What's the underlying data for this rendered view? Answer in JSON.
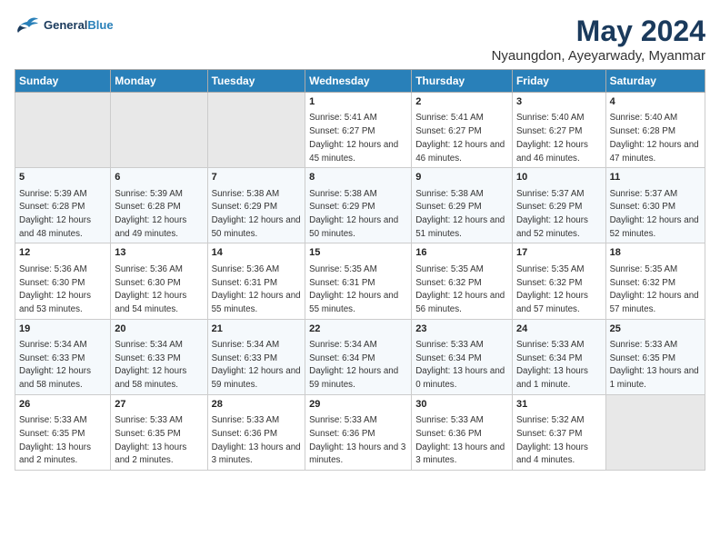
{
  "logo": {
    "line1": "General",
    "line2": "Blue"
  },
  "title": "May 2024",
  "subtitle": "Nyaungdon, Ayeyarwady, Myanmar",
  "days_of_week": [
    "Sunday",
    "Monday",
    "Tuesday",
    "Wednesday",
    "Thursday",
    "Friday",
    "Saturday"
  ],
  "weeks": [
    [
      {
        "day": "",
        "empty": true
      },
      {
        "day": "",
        "empty": true
      },
      {
        "day": "",
        "empty": true
      },
      {
        "day": "1",
        "sunrise": "5:41 AM",
        "sunset": "6:27 PM",
        "daylight": "12 hours and 45 minutes."
      },
      {
        "day": "2",
        "sunrise": "5:41 AM",
        "sunset": "6:27 PM",
        "daylight": "12 hours and 46 minutes."
      },
      {
        "day": "3",
        "sunrise": "5:40 AM",
        "sunset": "6:27 PM",
        "daylight": "12 hours and 46 minutes."
      },
      {
        "day": "4",
        "sunrise": "5:40 AM",
        "sunset": "6:28 PM",
        "daylight": "12 hours and 47 minutes."
      }
    ],
    [
      {
        "day": "5",
        "sunrise": "5:39 AM",
        "sunset": "6:28 PM",
        "daylight": "12 hours and 48 minutes."
      },
      {
        "day": "6",
        "sunrise": "5:39 AM",
        "sunset": "6:28 PM",
        "daylight": "12 hours and 49 minutes."
      },
      {
        "day": "7",
        "sunrise": "5:38 AM",
        "sunset": "6:29 PM",
        "daylight": "12 hours and 50 minutes."
      },
      {
        "day": "8",
        "sunrise": "5:38 AM",
        "sunset": "6:29 PM",
        "daylight": "12 hours and 50 minutes."
      },
      {
        "day": "9",
        "sunrise": "5:38 AM",
        "sunset": "6:29 PM",
        "daylight": "12 hours and 51 minutes."
      },
      {
        "day": "10",
        "sunrise": "5:37 AM",
        "sunset": "6:29 PM",
        "daylight": "12 hours and 52 minutes."
      },
      {
        "day": "11",
        "sunrise": "5:37 AM",
        "sunset": "6:30 PM",
        "daylight": "12 hours and 52 minutes."
      }
    ],
    [
      {
        "day": "12",
        "sunrise": "5:36 AM",
        "sunset": "6:30 PM",
        "daylight": "12 hours and 53 minutes."
      },
      {
        "day": "13",
        "sunrise": "5:36 AM",
        "sunset": "6:30 PM",
        "daylight": "12 hours and 54 minutes."
      },
      {
        "day": "14",
        "sunrise": "5:36 AM",
        "sunset": "6:31 PM",
        "daylight": "12 hours and 55 minutes."
      },
      {
        "day": "15",
        "sunrise": "5:35 AM",
        "sunset": "6:31 PM",
        "daylight": "12 hours and 55 minutes."
      },
      {
        "day": "16",
        "sunrise": "5:35 AM",
        "sunset": "6:32 PM",
        "daylight": "12 hours and 56 minutes."
      },
      {
        "day": "17",
        "sunrise": "5:35 AM",
        "sunset": "6:32 PM",
        "daylight": "12 hours and 57 minutes."
      },
      {
        "day": "18",
        "sunrise": "5:35 AM",
        "sunset": "6:32 PM",
        "daylight": "12 hours and 57 minutes."
      }
    ],
    [
      {
        "day": "19",
        "sunrise": "5:34 AM",
        "sunset": "6:33 PM",
        "daylight": "12 hours and 58 minutes."
      },
      {
        "day": "20",
        "sunrise": "5:34 AM",
        "sunset": "6:33 PM",
        "daylight": "12 hours and 58 minutes."
      },
      {
        "day": "21",
        "sunrise": "5:34 AM",
        "sunset": "6:33 PM",
        "daylight": "12 hours and 59 minutes."
      },
      {
        "day": "22",
        "sunrise": "5:34 AM",
        "sunset": "6:34 PM",
        "daylight": "12 hours and 59 minutes."
      },
      {
        "day": "23",
        "sunrise": "5:33 AM",
        "sunset": "6:34 PM",
        "daylight": "13 hours and 0 minutes."
      },
      {
        "day": "24",
        "sunrise": "5:33 AM",
        "sunset": "6:34 PM",
        "daylight": "13 hours and 1 minute."
      },
      {
        "day": "25",
        "sunrise": "5:33 AM",
        "sunset": "6:35 PM",
        "daylight": "13 hours and 1 minute."
      }
    ],
    [
      {
        "day": "26",
        "sunrise": "5:33 AM",
        "sunset": "6:35 PM",
        "daylight": "13 hours and 2 minutes."
      },
      {
        "day": "27",
        "sunrise": "5:33 AM",
        "sunset": "6:35 PM",
        "daylight": "13 hours and 2 minutes."
      },
      {
        "day": "28",
        "sunrise": "5:33 AM",
        "sunset": "6:36 PM",
        "daylight": "13 hours and 3 minutes."
      },
      {
        "day": "29",
        "sunrise": "5:33 AM",
        "sunset": "6:36 PM",
        "daylight": "13 hours and 3 minutes."
      },
      {
        "day": "30",
        "sunrise": "5:33 AM",
        "sunset": "6:36 PM",
        "daylight": "13 hours and 3 minutes."
      },
      {
        "day": "31",
        "sunrise": "5:32 AM",
        "sunset": "6:37 PM",
        "daylight": "13 hours and 4 minutes."
      },
      {
        "day": "",
        "empty": true
      }
    ]
  ],
  "labels": {
    "sunrise": "Sunrise:",
    "sunset": "Sunset:",
    "daylight": "Daylight:"
  }
}
